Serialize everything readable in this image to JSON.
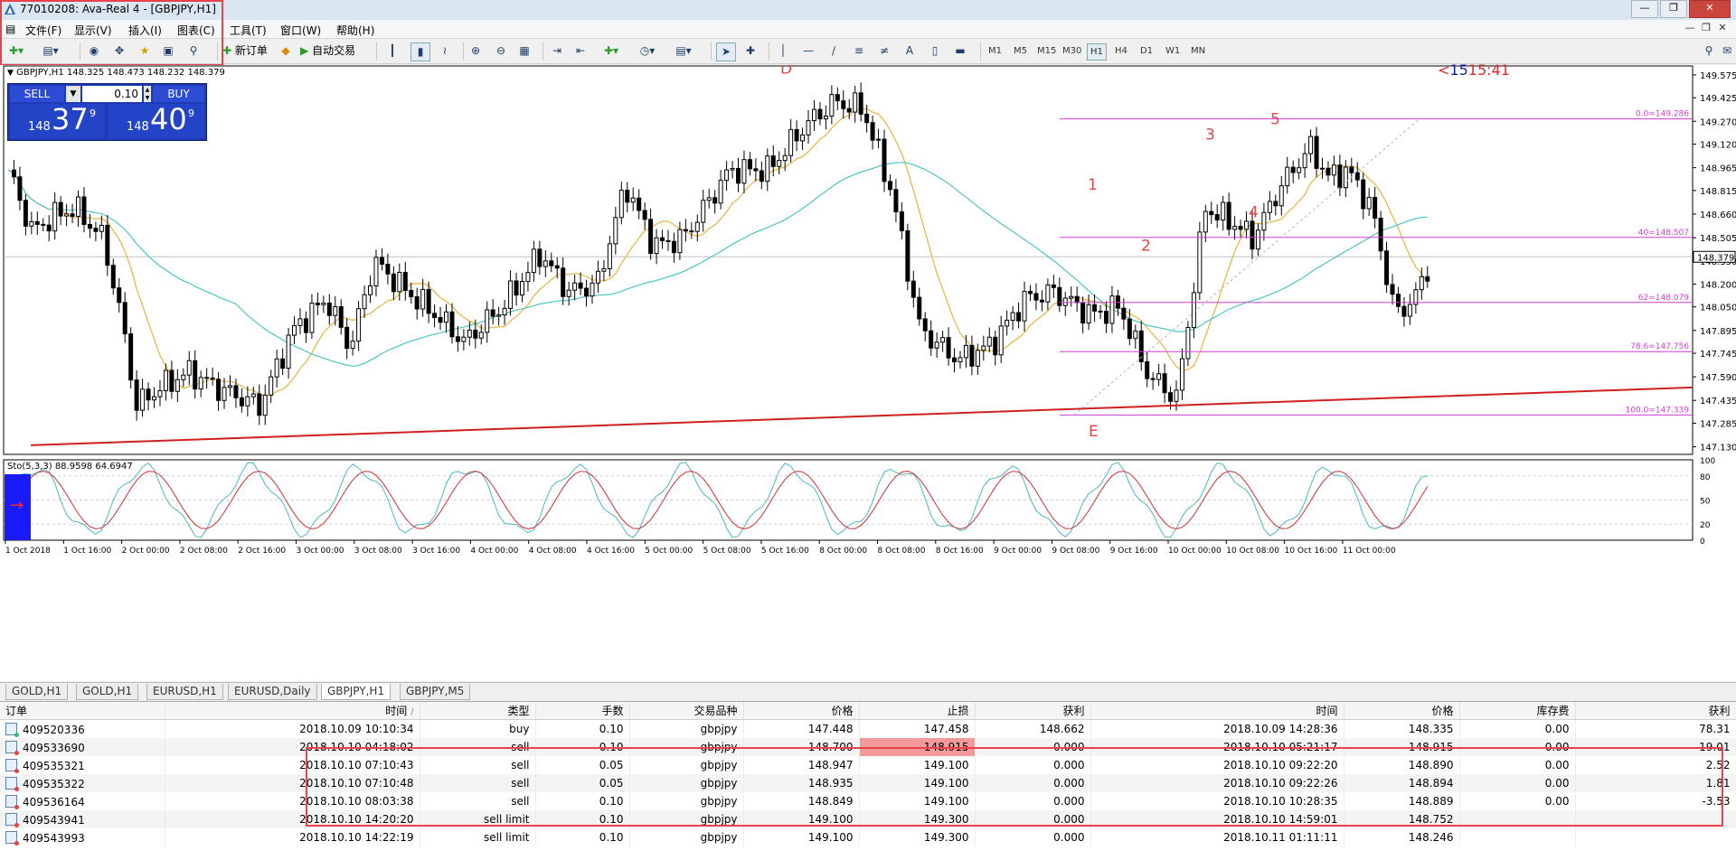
{
  "window": {
    "title": "77010208: Ava-Real 4 - [GBPJPY,H1]"
  },
  "menu": {
    "items": [
      "文件(F)",
      "显示(V)",
      "插入(I)",
      "图表(C)",
      "工具(T)",
      "窗口(W)",
      "帮助(H)"
    ]
  },
  "toolbar": {
    "new_order": "新订单",
    "auto_trade": "自动交易",
    "timeframes": [
      "M1",
      "M5",
      "M15",
      "M30",
      "H1",
      "H4",
      "D1",
      "W1",
      "MN"
    ],
    "active_timeframe": "H1",
    "text_tool": "A"
  },
  "chart": {
    "header": "GBPJPY,H1  148.325 148.473 148.232 148.379",
    "indicator_label": "Sto(5,3,3) 88.9598 64.6947",
    "countdown": "15:41",
    "countdown_prefix": "<",
    "trade_panel": {
      "sell_label": "SELL",
      "buy_label": "BUY",
      "lot": "0.10",
      "sell_big": "148",
      "sell_main": "37",
      "sell_sup": "9",
      "buy_big": "148",
      "buy_main": "40",
      "buy_sup": "9"
    },
    "price_axis": [
      "149.575",
      "149.425",
      "149.270",
      "149.120",
      "148.965",
      "148.815",
      "148.660",
      "148.505",
      "148.350",
      "148.200",
      "148.050",
      "147.895",
      "147.745",
      "147.590",
      "147.435",
      "147.285",
      "147.130"
    ],
    "current_price": "148.379",
    "fib_labels": [
      "0.0=149.286",
      "40=148.507",
      "62=148.079",
      "78.6=147.756",
      "100.0=147.339"
    ],
    "wave_labels": [
      "D",
      "E",
      "1",
      "2",
      "3",
      "4",
      "5"
    ],
    "stoch_axis": [
      "100",
      "80",
      "50",
      "20",
      "0"
    ],
    "time_axis": [
      "1 Oct 2018",
      "1 Oct 16:00",
      "2 Oct 00:00",
      "2 Oct 08:00",
      "2 Oct 16:00",
      "3 Oct 00:00",
      "3 Oct 08:00",
      "3 Oct 16:00",
      "4 Oct 00:00",
      "4 Oct 08:00",
      "4 Oct 16:00",
      "5 Oct 00:00",
      "5 Oct 08:00",
      "5 Oct 16:00",
      "8 Oct 00:00",
      "8 Oct 08:00",
      "8 Oct 16:00",
      "9 Oct 00:00",
      "9 Oct 08:00",
      "9 Oct 16:00",
      "10 Oct 00:00",
      "10 Oct 08:00",
      "10 Oct 16:00",
      "11 Oct 00:00"
    ]
  },
  "tabs": [
    "GOLD,H1",
    "GOLD,H1",
    "EURUSD,H1",
    "EURUSD,Daily",
    "GBPJPY,H1",
    "GBPJPY,M5"
  ],
  "active_tab": "GBPJPY,H1",
  "orders": {
    "columns": [
      "订单",
      "时间",
      "类型",
      "手数",
      "交易品种",
      "价格",
      "止损",
      "获利",
      "时间",
      "价格",
      "库存费",
      "获利"
    ],
    "sort_marker": "/",
    "rows": [
      [
        "409520336",
        "2018.10.09 10:10:34",
        "buy",
        "0.10",
        "gbpjpy",
        "147.448",
        "147.458",
        "148.662",
        "2018.10.09 14:28:36",
        "148.335",
        "0.00",
        "78.31"
      ],
      [
        "409533690",
        "2018.10.10 04:18:02",
        "sell",
        "0.10",
        "gbpjpy",
        "148.700",
        "148.915",
        "0.000",
        "2018.10.10 05:21:17",
        "148.915",
        "0.00",
        "-19.01"
      ],
      [
        "409535321",
        "2018.10.10 07:10:43",
        "sell",
        "0.05",
        "gbpjpy",
        "148.947",
        "149.100",
        "0.000",
        "2018.10.10 09:22:20",
        "148.890",
        "0.00",
        "2.52"
      ],
      [
        "409535322",
        "2018.10.10 07:10:48",
        "sell",
        "0.05",
        "gbpjpy",
        "148.935",
        "149.100",
        "0.000",
        "2018.10.10 09:22:26",
        "148.894",
        "0.00",
        "1.81"
      ],
      [
        "409536164",
        "2018.10.10 08:03:38",
        "sell",
        "0.10",
        "gbpjpy",
        "148.849",
        "149.100",
        "0.000",
        "2018.10.10 10:28:35",
        "148.889",
        "0.00",
        "-3.53"
      ],
      [
        "409543941",
        "2018.10.10 14:20:20",
        "sell limit",
        "0.10",
        "gbpjpy",
        "149.100",
        "149.300",
        "0.000",
        "2018.10.10 14:59:01",
        "148.752",
        "",
        ""
      ],
      [
        "409543993",
        "2018.10.10 14:22:19",
        "sell limit",
        "0.10",
        "gbpjpy",
        "149.100",
        "149.300",
        "0.000",
        "2018.10.11 01:11:11",
        "148.246",
        "",
        ""
      ]
    ],
    "highlight": {
      "row": 1,
      "col": 6,
      "color": "#f59a9a"
    }
  },
  "colors": {
    "bull": "#ffffff",
    "bear": "#000000",
    "ma_fast": "#e8b440",
    "ma_slow": "#4cc6c6",
    "fib": "#d23fd2",
    "trend": "#d01f1f",
    "annot": "#e8434a"
  }
}
